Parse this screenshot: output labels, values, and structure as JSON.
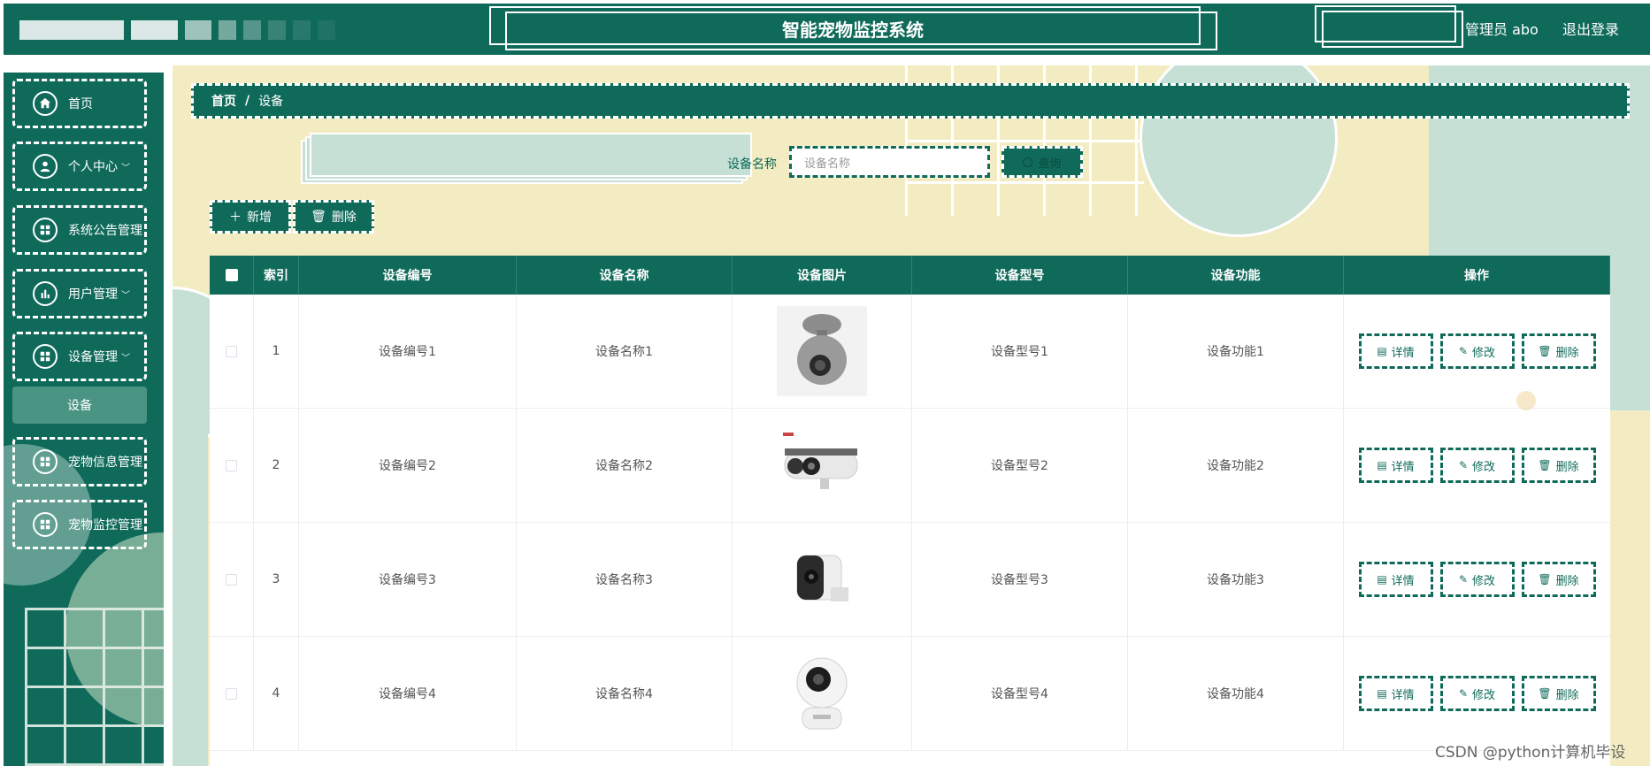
{
  "header": {
    "title": "智能宠物监控系统",
    "user": "管理员 abo",
    "logout": "退出登录"
  },
  "sidebar": {
    "items": [
      {
        "label": "首页",
        "icon": "home-icon"
      },
      {
        "label": "个人中心",
        "icon": "user-icon",
        "caret": "﹀"
      },
      {
        "label": "系统公告管理",
        "icon": "grid-icon"
      },
      {
        "label": "用户管理",
        "icon": "chart-icon",
        "caret": "﹀"
      },
      {
        "label": "设备管理",
        "icon": "grid-icon",
        "caret": "﹀"
      },
      {
        "label": "宠物信息管理",
        "icon": "grid-icon"
      },
      {
        "label": "宠物监控管理",
        "icon": "grid-icon"
      }
    ],
    "sub_active": "设备"
  },
  "breadcrumb": {
    "home": "首页",
    "sep": "/",
    "current": "设备"
  },
  "search": {
    "label": "设备名称",
    "placeholder": "设备名称",
    "button": "查询"
  },
  "actions": {
    "add": "新增",
    "delete": "删除"
  },
  "table": {
    "columns": [
      "索引",
      "设备编号",
      "设备名称",
      "设备图片",
      "设备型号",
      "设备功能",
      "操作"
    ],
    "rows": [
      {
        "index": "1",
        "code": "设备编号1",
        "name": "设备名称1",
        "model": "设备型号1",
        "func": "设备功能1"
      },
      {
        "index": "2",
        "code": "设备编号2",
        "name": "设备名称2",
        "model": "设备型号2",
        "func": "设备功能2"
      },
      {
        "index": "3",
        "code": "设备编号3",
        "name": "设备名称3",
        "model": "设备型号3",
        "func": "设备功能3"
      },
      {
        "index": "4",
        "code": "设备编号4",
        "name": "设备名称4",
        "model": "设备型号4",
        "func": "设备功能4"
      }
    ],
    "ops": {
      "detail": "详情",
      "edit": "修改",
      "delete": "删除"
    }
  },
  "watermark": "CSDN @python计算机毕设",
  "colors": {
    "primary": "#0f6a5a",
    "accent_bg": "#f3ecc2",
    "soft_green": "#c7e0d5"
  }
}
